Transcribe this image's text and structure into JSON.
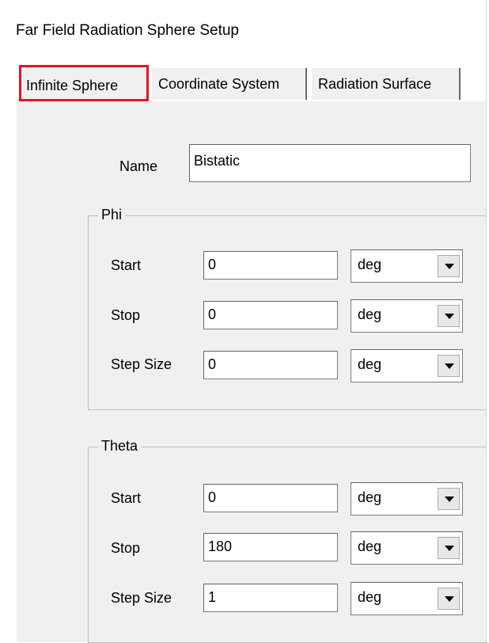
{
  "window": {
    "title": "Far Field Radiation Sphere Setup"
  },
  "tabs": [
    {
      "label": "Infinite Sphere",
      "selected": true,
      "highlight_color": "#e81123"
    },
    {
      "label": "Coordinate System"
    },
    {
      "label": "Radiation Surface"
    }
  ],
  "name_field": {
    "label": "Name",
    "value": "Bistatic"
  },
  "phi": {
    "title": "Phi",
    "start": {
      "label": "Start",
      "value": "0",
      "unit": "deg"
    },
    "stop": {
      "label": "Stop",
      "value": "0",
      "unit": "deg"
    },
    "step": {
      "label": "Step Size",
      "value": "0",
      "unit": "deg"
    }
  },
  "theta": {
    "title": "Theta",
    "start": {
      "label": "Start",
      "value": "0",
      "unit": "deg"
    },
    "stop": {
      "label": "Stop",
      "value": "180",
      "unit": "deg"
    },
    "step": {
      "label": "Step Size",
      "value": "1",
      "unit": "deg"
    }
  },
  "icons": {
    "dropdown": "chevron-down-icon"
  },
  "colors": {
    "panel_background": "#f0f0f0",
    "tab_highlight": "#e81123"
  }
}
